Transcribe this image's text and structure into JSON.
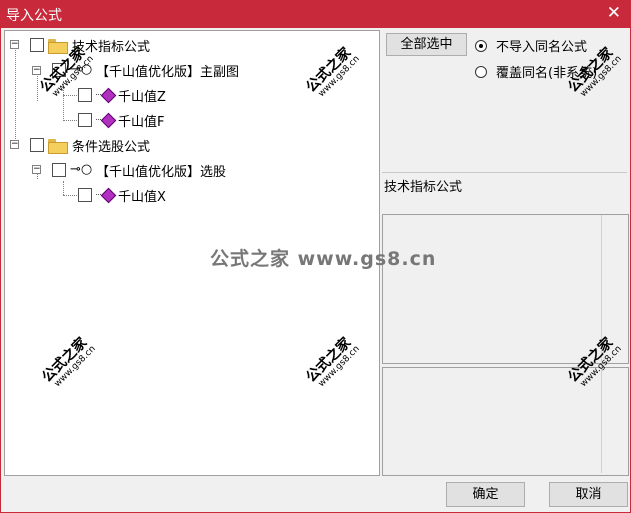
{
  "window": {
    "title": "导入公式"
  },
  "tree": {
    "categories": [
      {
        "label": "技术指标公式",
        "formula": "【千山值优化版】主副图",
        "items": [
          "千山值Z",
          "千山值F"
        ]
      },
      {
        "label": "条件选股公式",
        "formula": "【千山值优化版】选股",
        "items": [
          "千山值X"
        ]
      }
    ]
  },
  "controls": {
    "select_all": "全部选中",
    "radio_skip": "不导入同名公式",
    "radio_overwrite": "覆盖同名(非系统)",
    "selected_radio": "radio_skip",
    "info_label": "技术指标公式",
    "ok": "确定",
    "cancel": "取消"
  },
  "watermark": {
    "text": "公式之家",
    "url": "www.gs8.cn",
    "center": "公式之家 www.gs8.cn"
  }
}
